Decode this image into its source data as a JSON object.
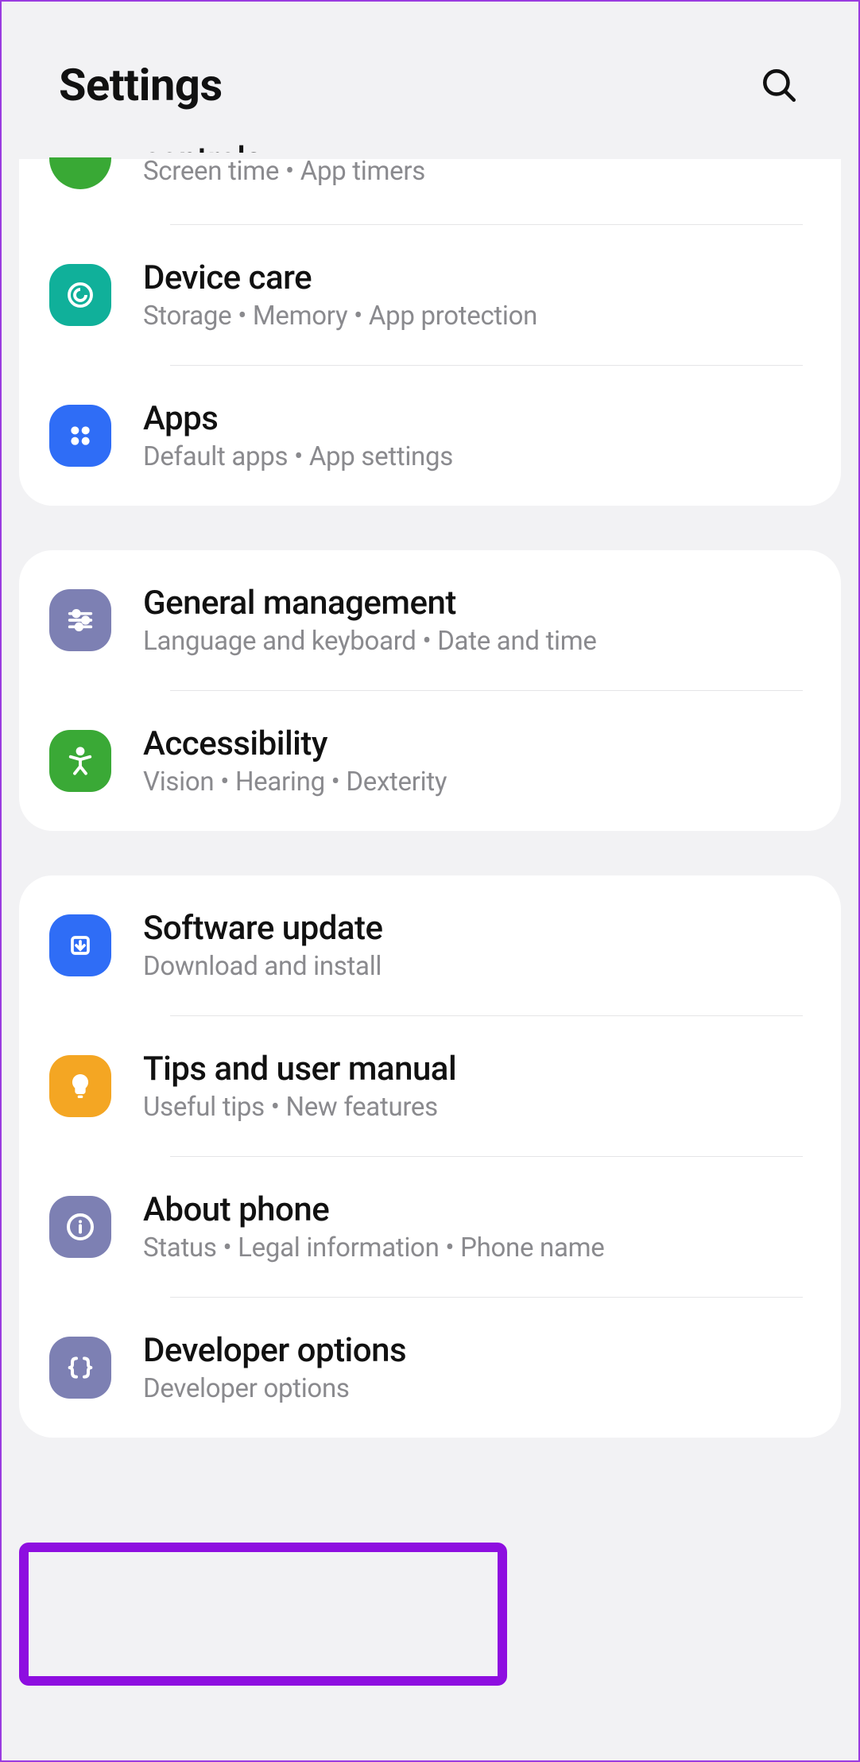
{
  "header": {
    "title": "Settings"
  },
  "groups": [
    {
      "items": [
        {
          "id": "digital-wellbeing",
          "title": "controls",
          "sub": "Screen time  •  App timers",
          "icon": "wellbeing",
          "color": "#39a935",
          "partial": true
        },
        {
          "id": "device-care",
          "title": "Device care",
          "sub": "Storage  •  Memory  •  App protection",
          "icon": "device-care",
          "color": "#10b09a"
        },
        {
          "id": "apps",
          "title": "Apps",
          "sub": "Default apps  •  App settings",
          "icon": "apps",
          "color": "#2f6df6"
        }
      ]
    },
    {
      "items": [
        {
          "id": "general-management",
          "title": "General management",
          "sub": "Language and keyboard  •  Date and time",
          "icon": "sliders",
          "color": "#7d80b3"
        },
        {
          "id": "accessibility",
          "title": "Accessibility",
          "sub": "Vision  •  Hearing  •  Dexterity",
          "icon": "accessibility",
          "color": "#3aa936"
        }
      ]
    },
    {
      "items": [
        {
          "id": "software-update",
          "title": "Software update",
          "sub": "Download and install",
          "icon": "update",
          "color": "#2f6df6"
        },
        {
          "id": "tips",
          "title": "Tips and user manual",
          "sub": "Useful tips  •  New features",
          "icon": "tip",
          "color": "#f4a623"
        },
        {
          "id": "about-phone",
          "title": "About phone",
          "sub": "Status  •  Legal information  •  Phone name",
          "icon": "info",
          "color": "#7d80b3"
        },
        {
          "id": "developer-options",
          "title": "Developer options",
          "sub": "Developer options",
          "icon": "dev",
          "color": "#7d80b3",
          "highlight": true
        }
      ]
    }
  ]
}
